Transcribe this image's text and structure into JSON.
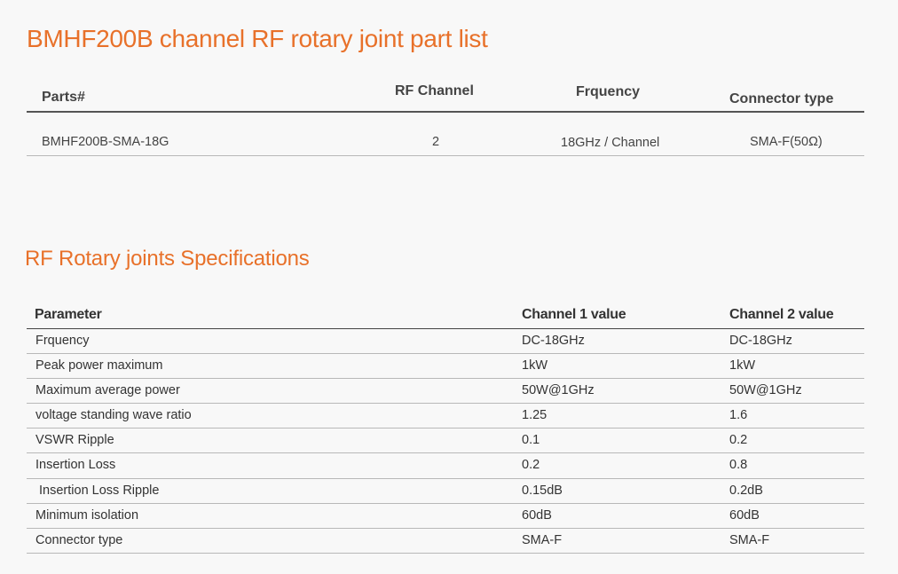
{
  "parts_section": {
    "title": "BMHF200B channel RF rotary joint part list",
    "headers": {
      "parts": "Parts#",
      "rf_channel": "RF Channel",
      "frequency": "Frquency",
      "connector": "Connector type"
    },
    "rows": [
      {
        "part": "BMHF200B-SMA-18G",
        "channel": "2",
        "frequency": "18GHz / Channel",
        "connector": "SMA-F(50Ω)"
      }
    ]
  },
  "specs_section": {
    "title": "RF Rotary joints Specifications",
    "headers": {
      "parameter": "Parameter",
      "ch1": "Channel 1 value",
      "ch2": "Channel 2 value"
    },
    "rows": [
      {
        "param": "Frquency",
        "ch1": "DC-18GHz",
        "ch2": "DC-18GHz"
      },
      {
        "param": "Peak power maximum",
        "ch1": "1kW",
        "ch2": "1kW"
      },
      {
        "param": "Maximum average power",
        "ch1": "50W@1GHz",
        "ch2": "50W@1GHz"
      },
      {
        "param": "voltage standing wave ratio",
        "ch1": "1.25",
        "ch2": "1.6"
      },
      {
        "param": "VSWR Ripple",
        "ch1": "0.1",
        "ch2": "0.2"
      },
      {
        "param": "Insertion Loss",
        "ch1": "0.2",
        "ch2": "0.8"
      },
      {
        "param": " Insertion Loss Ripple",
        "ch1": "0.15dB",
        "ch2": "0.2dB"
      },
      {
        "param": "Minimum isolation",
        "ch1": "60dB",
        "ch2": "60dB"
      },
      {
        "param": "Connector type",
        "ch1": "SMA-F",
        "ch2": "SMA-F"
      }
    ]
  },
  "colors": {
    "accent": "#e8712a",
    "text": "#333333",
    "background": "#f8f8f8"
  }
}
